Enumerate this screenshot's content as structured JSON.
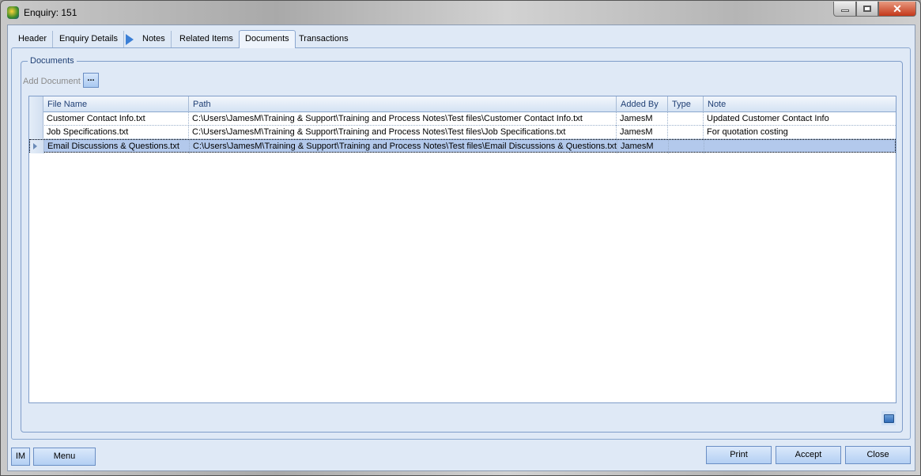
{
  "window": {
    "title": "Enquiry: 151"
  },
  "tabs": [
    {
      "label": "Header"
    },
    {
      "label": "Enquiry Details"
    },
    {
      "label": "Notes"
    },
    {
      "label": "Related Items"
    },
    {
      "label": "Documents"
    },
    {
      "label": "Transactions"
    }
  ],
  "documents": {
    "group_label": "Documents",
    "add_document_label": "Add Document",
    "browse_label": "...",
    "columns": [
      "File Name",
      "Path",
      "Added By",
      "Type",
      "Note"
    ],
    "rows": [
      {
        "file_name": "Customer Contact Info.txt",
        "path": "C:\\Users\\JamesM\\Training & Support\\Training and Process Notes\\Test files\\Customer Contact Info.txt",
        "added_by": "JamesM",
        "type": "",
        "note": "Updated Customer Contact Info"
      },
      {
        "file_name": "Job Specifications.txt",
        "path": "C:\\Users\\JamesM\\Training & Support\\Training and Process Notes\\Test files\\Job Specifications.txt",
        "added_by": "JamesM",
        "type": "",
        "note": "For quotation costing"
      },
      {
        "file_name": "Email Discussions & Questions.txt",
        "path": "C:\\Users\\JamesM\\Training & Support\\Training and Process Notes\\Test files\\Email Discussions & Questions.txt",
        "added_by": "JamesM",
        "type": "",
        "note": ""
      }
    ],
    "selected_row": 2
  },
  "footer": {
    "im_label": "IM",
    "menu_label": "Menu",
    "print_label": "Print",
    "accept_label": "Accept",
    "close_label": "Close"
  }
}
